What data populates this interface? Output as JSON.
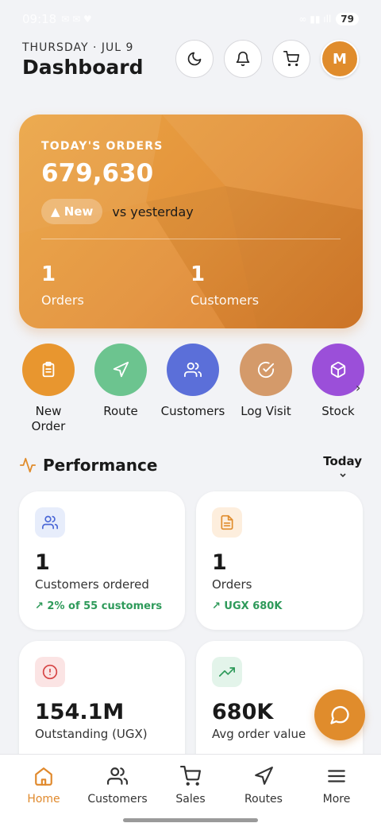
{
  "status_bar": {
    "time": "09:18",
    "battery": "79"
  },
  "header": {
    "date": "THURSDAY · JUL 9",
    "title": "Dashboard",
    "avatar_initial": "M"
  },
  "hero": {
    "label": "TODAY'S ORDERS",
    "value": "679,630",
    "badge": "▲ New",
    "comparison": "vs yesterday",
    "stats": [
      {
        "value": "1",
        "label": "Orders"
      },
      {
        "value": "1",
        "label": "Customers"
      }
    ]
  },
  "quick_actions": [
    {
      "label": "New\nOrder",
      "color": "#e8962f",
      "icon": "clipboard-icon"
    },
    {
      "label": "Route",
      "color": "#6cc48f",
      "icon": "navigation-icon"
    },
    {
      "label": "Customers",
      "color": "#5b6fd9",
      "icon": "users-icon"
    },
    {
      "label": "Log Visit",
      "color": "#d49a6a",
      "icon": "check-circle-icon"
    },
    {
      "label": "Stock",
      "color": "#9b4fd9",
      "icon": "box-icon"
    }
  ],
  "performance": {
    "title": "Performance",
    "period": "Today",
    "cards": [
      {
        "value": "1",
        "label": "Customers ordered",
        "sub": "2% of 55 customers",
        "icon": "users-icon",
        "icon_bg": "#e7edfb"
      },
      {
        "value": "1",
        "label": "Orders",
        "sub": "UGX 680K",
        "icon": "document-icon",
        "icon_bg": "#fdeedd"
      },
      {
        "value": "154.1M",
        "label": "Outstanding (UGX)",
        "sub": "",
        "icon": "alert-circle-icon",
        "icon_bg": "#fbe4e4"
      },
      {
        "value": "680K",
        "label": "Avg order value",
        "sub": "",
        "icon": "trending-up-icon",
        "icon_bg": "#e3f4ea"
      }
    ]
  },
  "bottom_nav": [
    {
      "label": "Home",
      "active": true
    },
    {
      "label": "Customers"
    },
    {
      "label": "Sales"
    },
    {
      "label": "Routes"
    },
    {
      "label": "More"
    }
  ],
  "colors": {
    "accent": "#e08c2c",
    "positive": "#2e9a5a"
  }
}
